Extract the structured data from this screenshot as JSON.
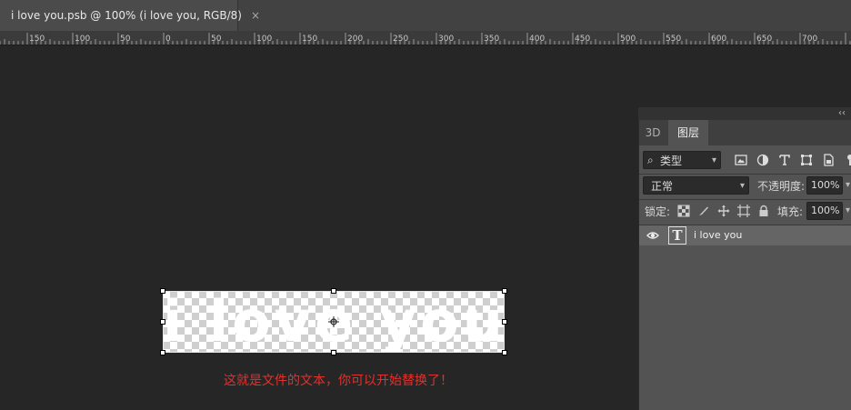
{
  "document_tab": {
    "title": "i love you.psb @ 100% (i love you, RGB/8)",
    "close_glyph": "×"
  },
  "ruler": {
    "labels": [
      "150",
      "100",
      "50",
      "0",
      "50",
      "100",
      "150",
      "200",
      "250",
      "300",
      "350",
      "400",
      "450",
      "500",
      "550",
      "600",
      "650",
      "700"
    ]
  },
  "canvas": {
    "layer_text": "i love you",
    "caption": "这就是文件的文本，你可以开始替换了！",
    "caption_color": "#e0322d"
  },
  "panel": {
    "collapse_glyph": "‹‹",
    "tabs": [
      {
        "label": "3D"
      },
      {
        "label": "图层"
      }
    ],
    "filter": {
      "label": "类型",
      "icons": [
        "image-filter-icon",
        "adjustment-filter-icon",
        "type-filter-icon",
        "shape-filter-icon",
        "smart-object-filter-icon"
      ]
    },
    "blend_mode": "正常",
    "opacity_label": "不透明度:",
    "opacity_value": "100%",
    "lock_label": "锁定:",
    "lock_icons": [
      "lock-transparent-icon",
      "lock-image-icon",
      "lock-position-icon",
      "lock-artboard-icon",
      "lock-all-icon"
    ],
    "fill_label": "填充:",
    "fill_value": "100%",
    "layers": [
      {
        "name": "i love you",
        "kind": "text",
        "thumb_glyph": "T"
      }
    ]
  }
}
